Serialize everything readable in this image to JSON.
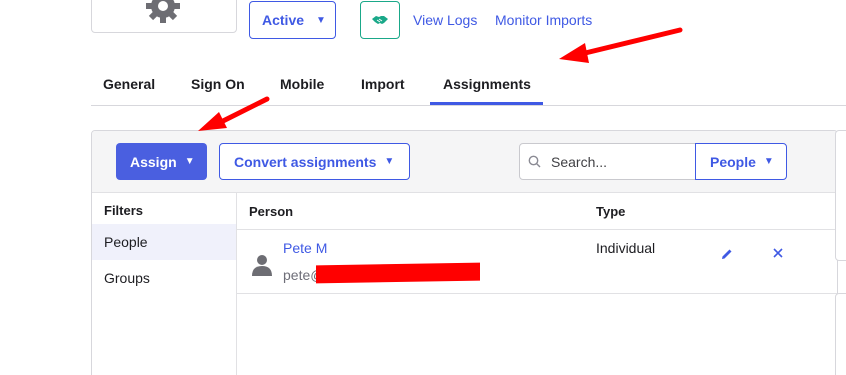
{
  "header": {
    "status_label": "Active",
    "links": [
      "View Logs",
      "Monitor Imports"
    ]
  },
  "tabs": [
    {
      "label": "General"
    },
    {
      "label": "Sign On"
    },
    {
      "label": "Mobile"
    },
    {
      "label": "Import"
    },
    {
      "label": "Assignments",
      "active": true
    }
  ],
  "toolbar": {
    "assign_label": "Assign",
    "convert_label": "Convert assignments",
    "search_placeholder": "Search...",
    "people_label": "People"
  },
  "filters": {
    "title": "Filters",
    "items": [
      {
        "label": "People",
        "active": true
      },
      {
        "label": "Groups"
      }
    ]
  },
  "table": {
    "columns": [
      "Person",
      "Type"
    ],
    "rows": [
      {
        "name": "Pete M",
        "email": "pete@",
        "type": "Individual"
      }
    ]
  },
  "icons": [
    "gear-icon",
    "caret-down-icon",
    "handshake-icon",
    "search-icon",
    "user-avatar-icon",
    "pencil-icon",
    "close-icon"
  ],
  "colors": {
    "accent": "#3f59e4",
    "assign_button": "#4a5fe0",
    "handshake": "#1aa889",
    "annotation_arrow": "#ff0000",
    "redaction": "#ff0000"
  }
}
